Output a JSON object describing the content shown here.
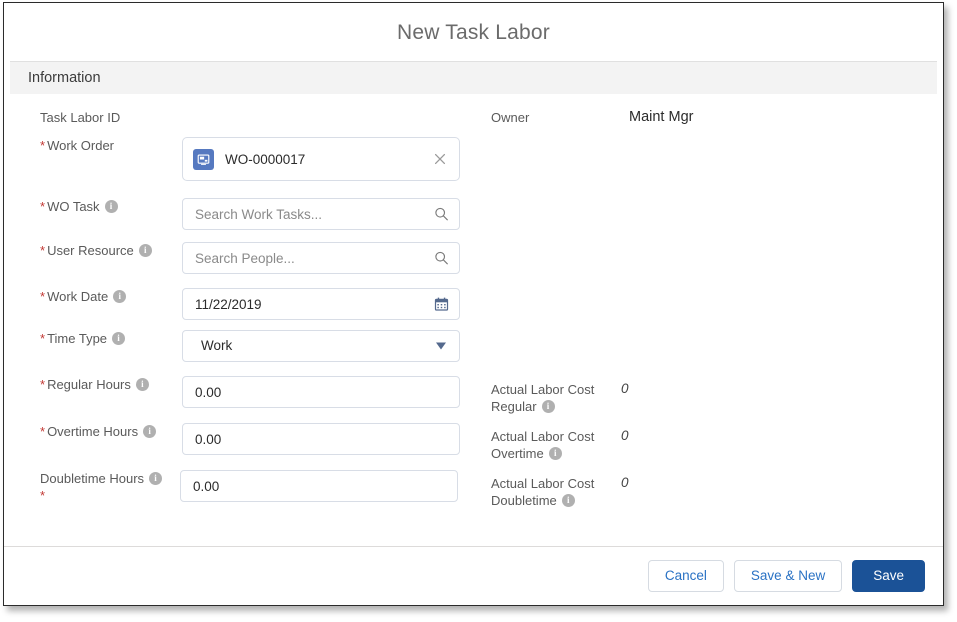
{
  "modal": {
    "title": "New Task Labor",
    "section_title": "Information"
  },
  "left_fields": {
    "task_labor_id": {
      "label": "Task Labor ID",
      "required": false,
      "has_info": false
    },
    "work_order": {
      "label": "Work Order",
      "required": true,
      "has_info": false,
      "value": "WO-0000017",
      "entity_icon": "work-order-icon",
      "clear_icon": "close-icon"
    },
    "wo_task": {
      "label": "WO Task",
      "required": true,
      "has_info": true,
      "value": "",
      "placeholder": "Search Work Tasks...",
      "icon": "search-icon"
    },
    "user_resource": {
      "label": "User Resource",
      "required": true,
      "has_info": true,
      "value": "",
      "placeholder": "Search People...",
      "icon": "search-icon"
    },
    "work_date": {
      "label": "Work Date",
      "required": true,
      "has_info": true,
      "value": "11/22/2019",
      "icon": "calendar-icon"
    },
    "time_type": {
      "label": "Time Type",
      "required": true,
      "has_info": true,
      "value": "Work",
      "icon": "chevron-down-icon",
      "options": [
        "Work"
      ]
    },
    "regular_hours": {
      "label": "Regular Hours",
      "required": true,
      "has_info": true,
      "value": "0.00"
    },
    "overtime_hours": {
      "label": "Overtime Hours",
      "required": true,
      "has_info": true,
      "value": "0.00"
    },
    "doubletime_hours": {
      "label": "Doubletime Hours",
      "required": true,
      "has_info": true,
      "value": "0.00"
    }
  },
  "right_fields": {
    "owner": {
      "label": "Owner",
      "value": "Maint Mgr",
      "has_info": false
    },
    "actual_labor_cost_regular": {
      "label": "Actual Labor Cost Regular",
      "value": "0",
      "has_info": true
    },
    "actual_labor_cost_overtime": {
      "label": "Actual Labor Cost Overtime",
      "value": "0",
      "has_info": true
    },
    "actual_labor_cost_doubletime": {
      "label": "Actual Labor Cost Doubletime",
      "value": "0",
      "has_info": true
    }
  },
  "footer": {
    "cancel_label": "Cancel",
    "save_new_label": "Save & New",
    "save_label": "Save"
  },
  "colors": {
    "brand_blue": "#1b5297",
    "link_blue": "#2a72c4",
    "required_red": "#c23934",
    "section_band": "#f3f3f3",
    "border_gray": "#d8dde6",
    "entity_icon_blue": "#5679c0"
  }
}
